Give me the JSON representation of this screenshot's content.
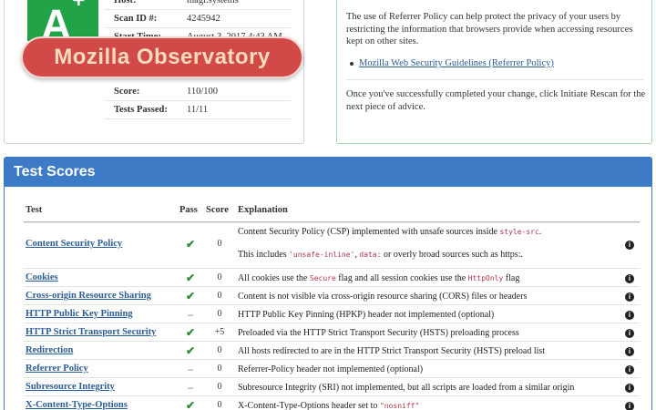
{
  "summary": {
    "grade": "A",
    "grade_modifier": "+",
    "banner": "Mozilla Observatory",
    "rows": [
      {
        "label": "Host:",
        "value": "magi.systems"
      },
      {
        "label": "Scan ID #:",
        "value": "4245942"
      },
      {
        "label": "Start Time:",
        "value": "August 3, 2017 4:43 AM"
      },
      {
        "label": "Score:",
        "value": "110/100"
      },
      {
        "label": "Tests Passed:",
        "value": "11/11"
      }
    ]
  },
  "advice": {
    "paragraph1": "The use of Referrer Policy can help protect the privacy of your users by restricting the information that browsers provide when accessing resources kept on other sites.",
    "link": "Mozilla Web Security Guidelines (Referrer Policy)",
    "paragraph2": "Once you've successfully completed your change, click Initiate Rescan for the next piece of advice."
  },
  "scores": {
    "title": "Test Scores",
    "columns": {
      "test": "Test",
      "pass": "Pass",
      "score": "Score",
      "explanation": "Explanation"
    },
    "pass_symbols": {
      "pass": "✔",
      "neutral": "–"
    },
    "info_symbol": "i",
    "rows": [
      {
        "name": "Content Security Policy",
        "pass": "pass",
        "score": "0",
        "expl": [
          [
            "Content Security Policy (CSP) implemented with unsafe sources inside ",
            "style-src",
            "."
          ]
        ],
        "expl2": [
          "This includes ",
          "'unsafe-inline'",
          ", ",
          "data:",
          " or overly broad sources such as https:."
        ]
      },
      {
        "name": "Cookies",
        "pass": "pass",
        "score": "0",
        "expl": [
          [
            "All cookies use the ",
            "Secure",
            " flag and all session cookies use the ",
            "HttpOnly",
            " flag"
          ]
        ]
      },
      {
        "name": "Cross-origin Resource Sharing",
        "pass": "pass",
        "score": "0",
        "expl": [
          [
            "Content is not visible via cross-origin resource sharing (CORS) files or headers"
          ]
        ]
      },
      {
        "name": "HTTP Public Key Pinning",
        "pass": "neutral",
        "score": "0",
        "expl": [
          [
            "HTTP Public Key Pinning (HPKP) header not implemented (optional)"
          ]
        ]
      },
      {
        "name": "HTTP Strict Transport Security",
        "pass": "pass",
        "score": "+5",
        "expl": [
          [
            "Preloaded via the HTTP Strict Transport Security (HSTS) preloading process"
          ]
        ]
      },
      {
        "name": "Redirection",
        "pass": "pass",
        "score": "0",
        "expl": [
          [
            "All hosts redirected to are in the HTTP Strict Transport Security (HSTS) preload list"
          ]
        ]
      },
      {
        "name": "Referrer Policy",
        "pass": "neutral",
        "score": "0",
        "expl": [
          [
            "Referrer-Policy header not implemented (optional)"
          ]
        ]
      },
      {
        "name": "Subresource Integrity",
        "pass": "neutral",
        "score": "0",
        "expl": [
          [
            "Subresource Integrity (SRI) not implemented, but all scripts are loaded from a similar origin"
          ]
        ]
      },
      {
        "name": "X-Content-Type-Options",
        "pass": "pass",
        "score": "0",
        "expl": [
          [
            "X-Content-Type-Options header set to ",
            "\"nosniff\""
          ]
        ]
      }
    ]
  },
  "colors": {
    "grade_bg": "#22a348",
    "banner_bg": "#d14a47",
    "panel_header": "#3d7bc6",
    "link": "#2b5d97",
    "pass_check": "#2d8a3e"
  }
}
